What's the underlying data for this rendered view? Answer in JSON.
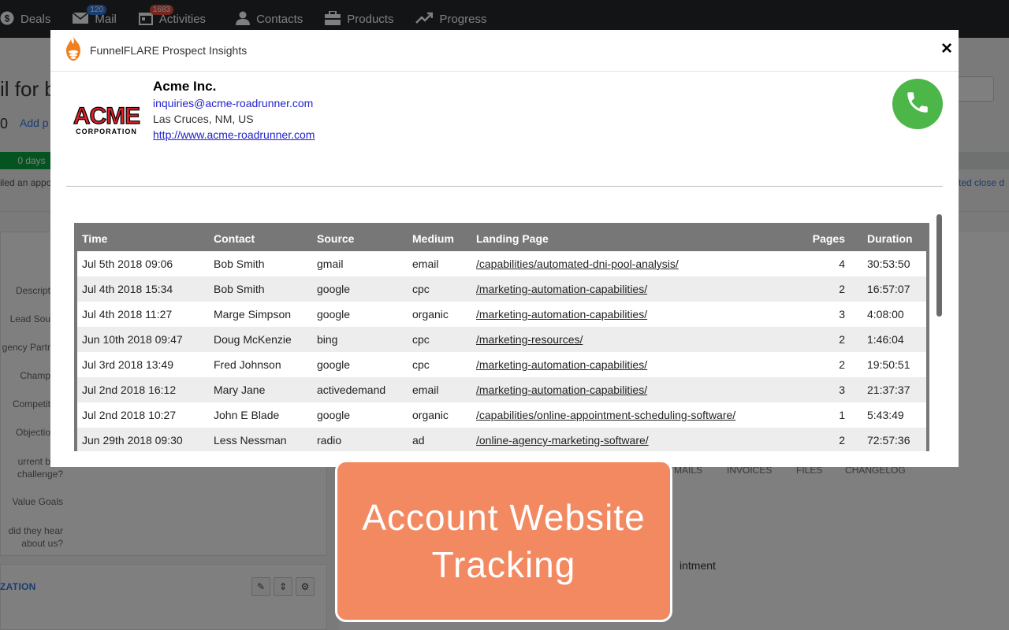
{
  "nav": {
    "items": [
      {
        "label": "Deals",
        "icon": "dollar-icon",
        "badge": ""
      },
      {
        "label": "Mail",
        "icon": "mail-icon",
        "badge": "120"
      },
      {
        "label": "Activities",
        "icon": "calendar-icon",
        "badge": "1683"
      },
      {
        "label": "Contacts",
        "icon": "person-icon",
        "badge": ""
      },
      {
        "label": "Products",
        "icon": "box-icon",
        "badge": ""
      },
      {
        "label": "Progress",
        "icon": "trend-icon",
        "badge": ""
      }
    ]
  },
  "background": {
    "title": "il for b",
    "zero": "0",
    "add_product": "Add p",
    "days": "0 days",
    "note": "iled an appo",
    "close_link": "cted close d",
    "fields": [
      "Descript",
      "Lead Sou",
      "gency Partr",
      "Champ",
      "Competit",
      "Objectio"
    ],
    "field_challenge": "urrent bigg\nchallenge?",
    "field_value_goals": "Value Goals",
    "field_hear": "did they hear\nabout us?",
    "org_label": "ZATION",
    "tabs": [
      "MAILS",
      "INVOICES",
      "FILES",
      "CHANGELOG"
    ],
    "ointment": "intment"
  },
  "modal": {
    "title": "FunnelFLARE Prospect Insights",
    "close_symbol": "×",
    "company": {
      "name": "Acme Inc.",
      "email": "inquiries@acme-roadrunner.com",
      "location": "Las Cruces, NM, US",
      "url": "http://www.acme-roadrunner.com",
      "logo_text": "ACME",
      "logo_sub": "CORPORATION"
    },
    "table": {
      "headers": [
        "Time",
        "Contact",
        "Source",
        "Medium",
        "Landing Page",
        "Pages",
        "Duration"
      ],
      "rows": [
        [
          "Jul 5th 2018 09:06",
          "Bob Smith",
          "gmail",
          "email",
          "/capabilities/automated-dni-pool-analysis/",
          "4",
          "30:53:50"
        ],
        [
          "Jul 4th 2018 15:34",
          "Bob Smith",
          "google",
          "cpc",
          "/marketing-automation-capabilities/",
          "2",
          "16:57:07"
        ],
        [
          "Jul 4th 2018 11:27",
          "Marge Simpson",
          "google",
          "organic",
          "/marketing-automation-capabilities/",
          "3",
          "4:08:00"
        ],
        [
          "Jun 10th 2018 09:47",
          "Doug McKenzie",
          "bing",
          "cpc",
          "/marketing-resources/",
          "2",
          "1:46:04"
        ],
        [
          "Jul 3rd 2018 13:49",
          "Fred Johnson",
          "google",
          "cpc",
          "/marketing-automation-capabilities/",
          "2",
          "19:50:51"
        ],
        [
          "Jul 2nd 2018 16:12",
          "Mary Jane",
          "activedemand",
          "email",
          "/marketing-automation-capabilities/",
          "3",
          "21:37:37"
        ],
        [
          "Jul 2nd 2018 10:27",
          "John E Blade",
          "google",
          "organic",
          "/capabilities/online-appointment-scheduling-software/",
          "1",
          "5:43:49"
        ],
        [
          "Jun 29th 2018 09:30",
          "Less Nessman",
          "radio",
          "ad",
          "/online-agency-marketing-software/",
          "2",
          "72:57:36"
        ]
      ]
    }
  },
  "banner": {
    "text": "Account Website Tracking"
  },
  "colors": {
    "nav_bg": "#26292c",
    "badge_mail": "#317ae2",
    "badge_activities": "#e84e3f",
    "call_green": "#4cb648",
    "banner_orange": "#f38961",
    "table_header": "#777777"
  }
}
